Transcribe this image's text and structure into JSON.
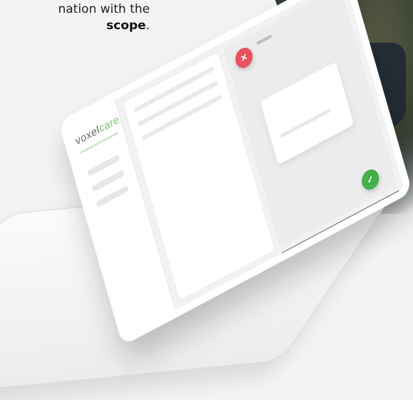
{
  "intro": {
    "line1": "nation with the",
    "line2_bold": "scope",
    "line2_punct": "."
  },
  "app": {
    "logo_prefix": "voxel",
    "logo_accent": "care",
    "accent_color": "#7cc46f"
  },
  "call": {
    "end_button_icon": "phone-end-icon",
    "accept_button_icon": "phone-accept-icon",
    "end_color": "#e8525f",
    "accept_color": "#43b04a"
  }
}
